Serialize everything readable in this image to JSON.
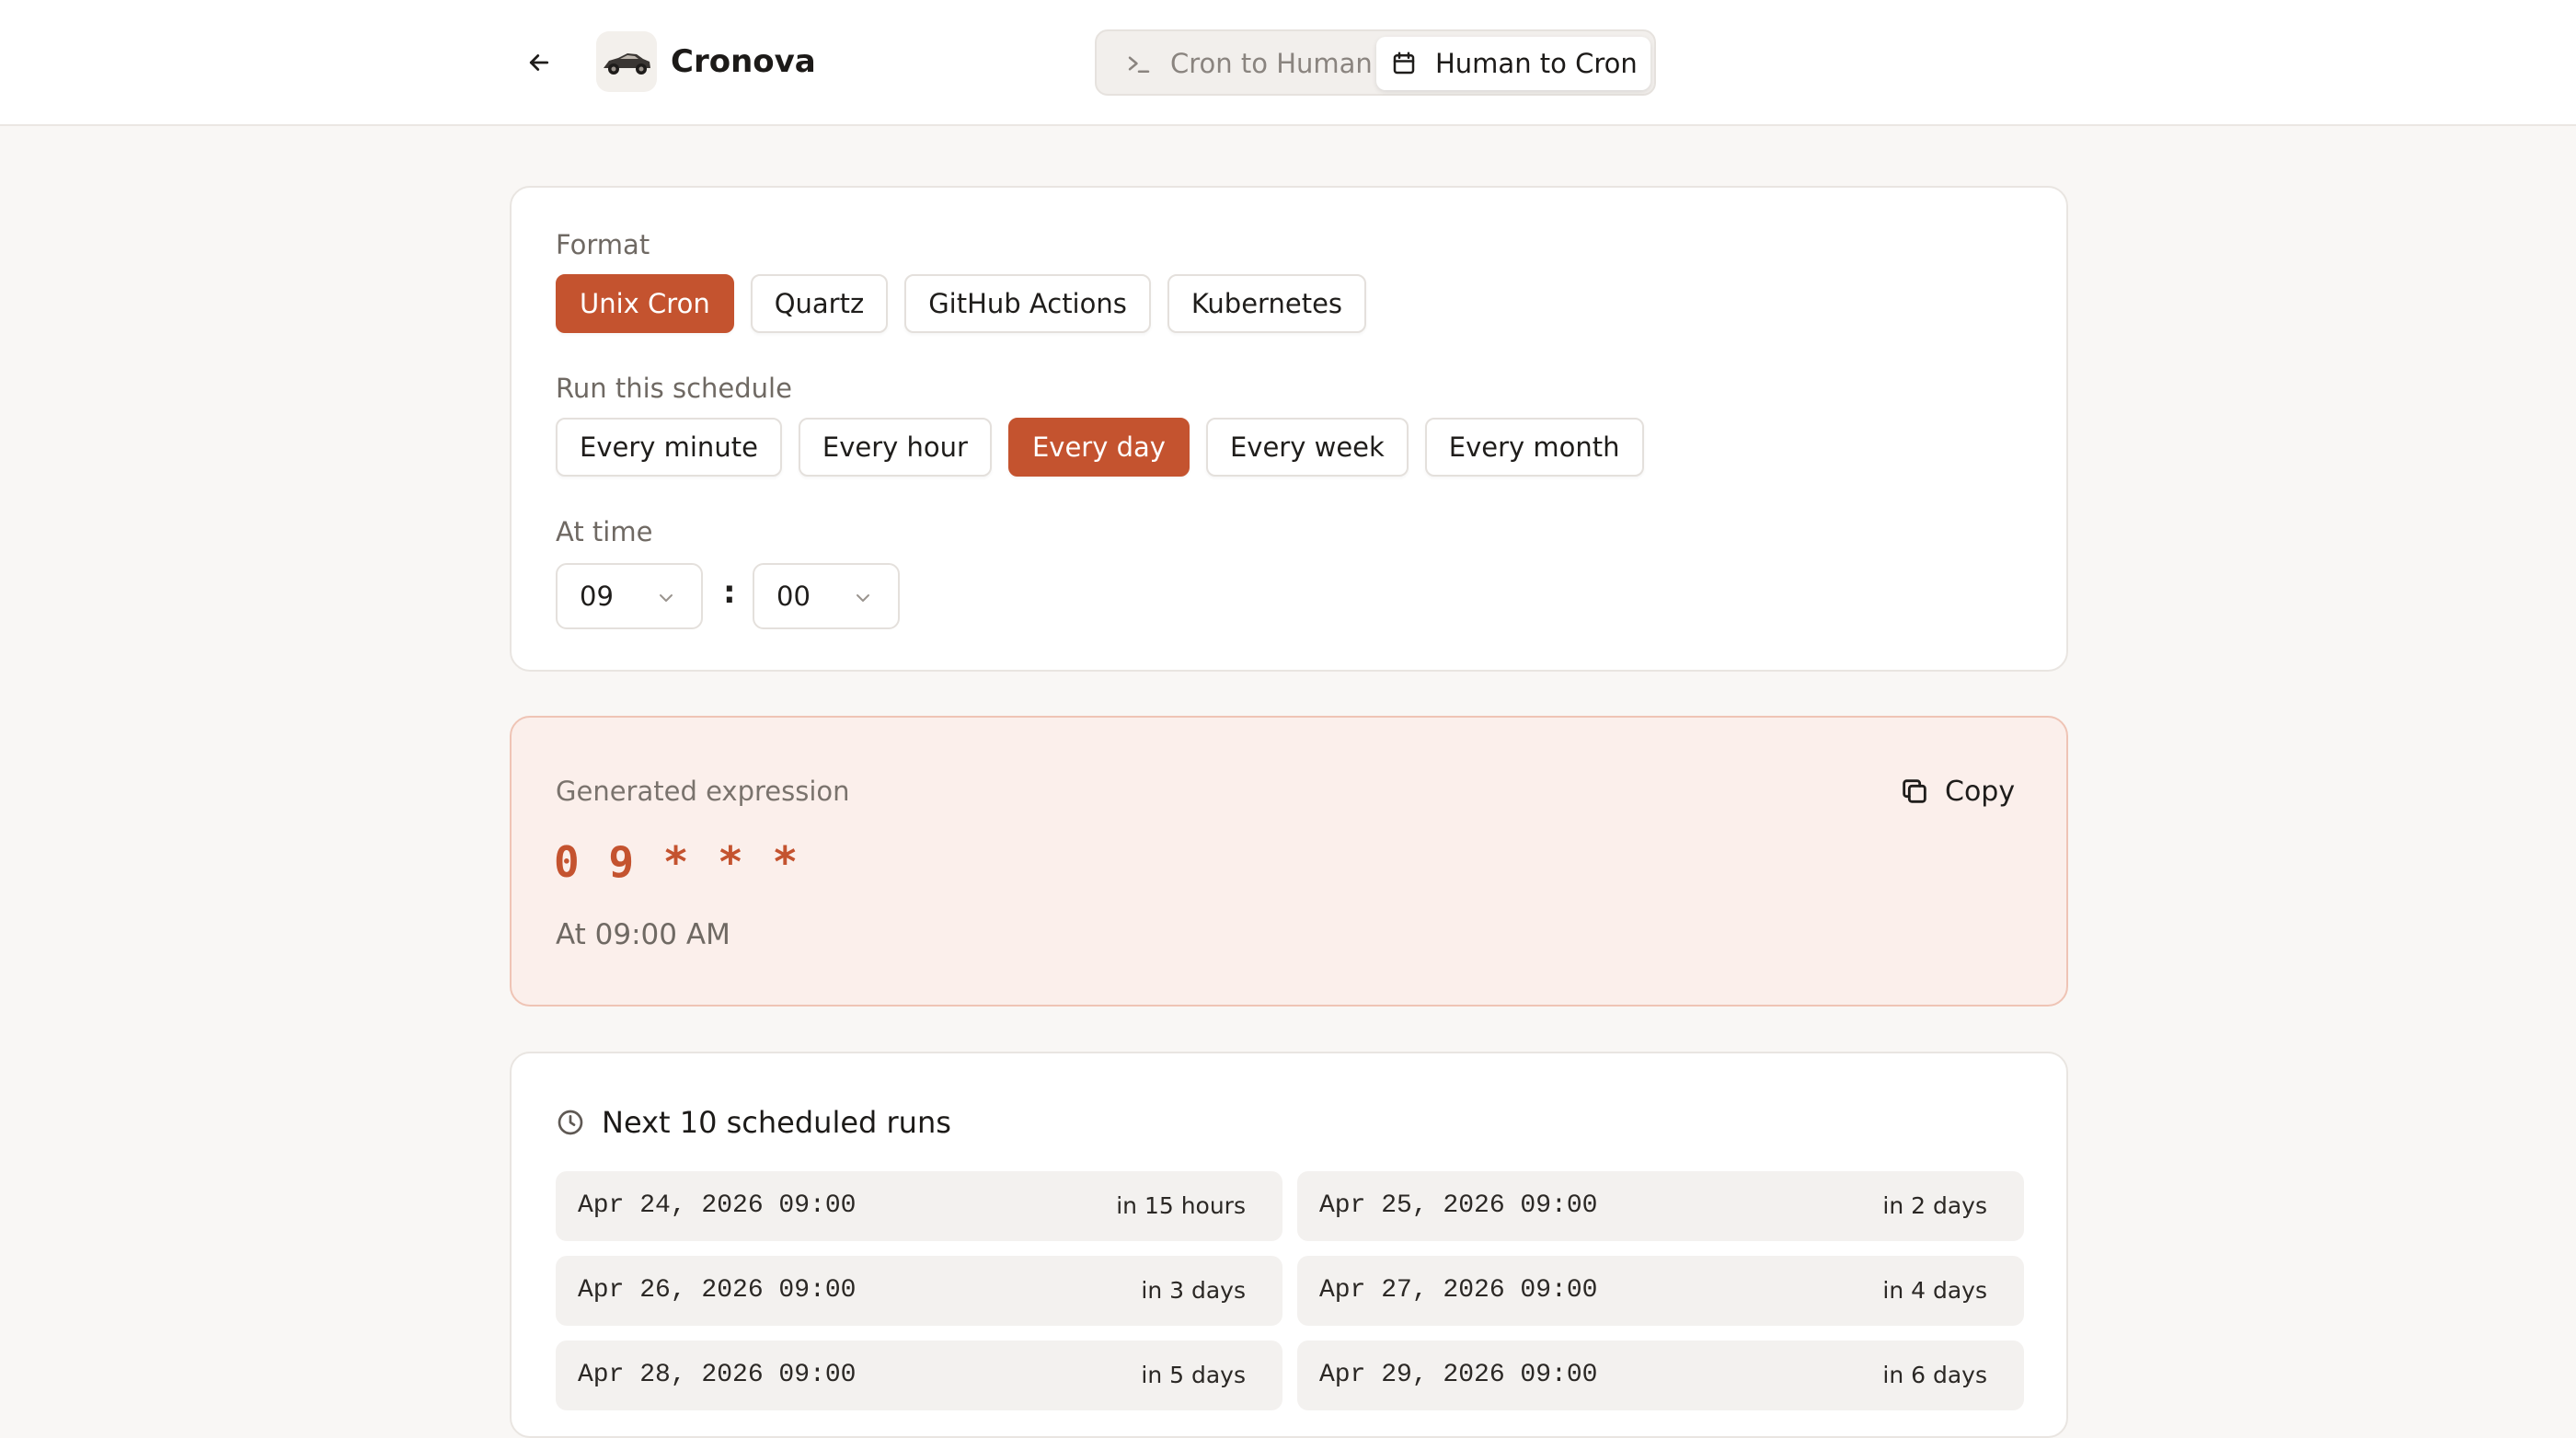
{
  "header": {
    "app_name": "Cronova",
    "back_icon": "arrow-left-icon",
    "logo_icon": "car-logo",
    "modes": [
      {
        "label": "Cron to Human",
        "icon": "terminal-icon",
        "active": false
      },
      {
        "label": "Human to Cron",
        "icon": "calendar-icon",
        "active": true
      }
    ]
  },
  "format": {
    "label": "Format",
    "options": [
      "Unix Cron",
      "Quartz",
      "GitHub Actions",
      "Kubernetes"
    ],
    "selected": "Unix Cron"
  },
  "schedule": {
    "label": "Run this schedule",
    "options": [
      "Every minute",
      "Every hour",
      "Every day",
      "Every week",
      "Every month"
    ],
    "selected": "Every day"
  },
  "time": {
    "label": "At time",
    "hour": "09",
    "separator": ":",
    "minute": "00"
  },
  "expression": {
    "label": "Generated expression",
    "value": "0 9 * * *",
    "description": "At 09:00 AM",
    "copy_label": "Copy"
  },
  "runs": {
    "title": "Next 10 scheduled runs",
    "items": [
      {
        "date": "Apr 24, 2026 09:00",
        "relative": "in 15 hours"
      },
      {
        "date": "Apr 25, 2026 09:00",
        "relative": "in 2 days"
      },
      {
        "date": "Apr 26, 2026 09:00",
        "relative": "in 3 days"
      },
      {
        "date": "Apr 27, 2026 09:00",
        "relative": "in 4 days"
      },
      {
        "date": "Apr 28, 2026 09:00",
        "relative": "in 5 days"
      },
      {
        "date": "Apr 29, 2026 09:00",
        "relative": "in 6 days"
      }
    ]
  },
  "colors": {
    "accent": "#c4532f",
    "expression_bg": "#fbefeb",
    "page_bg": "#f9f7f5"
  }
}
